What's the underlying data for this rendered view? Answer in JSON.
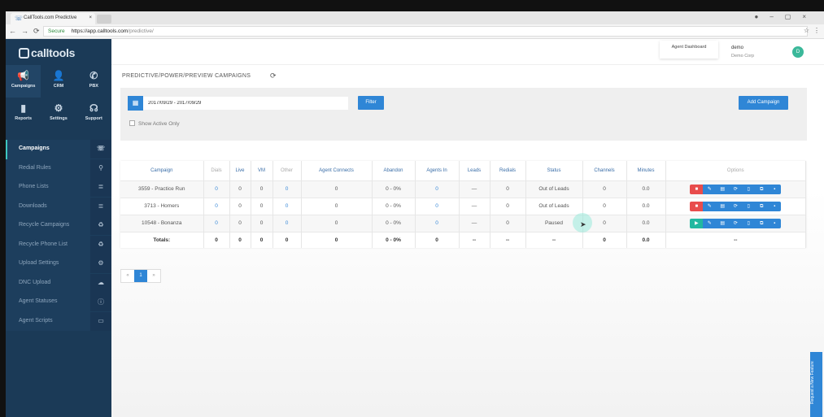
{
  "browser": {
    "tab_title": "CallTools.com Predictive",
    "url_secure": "Secure",
    "url_host": "https://app.calltools.com",
    "url_path": "/predictive/"
  },
  "sidebar": {
    "logo": "calltools",
    "grid": [
      {
        "label": "Campaigns",
        "icon": "megaphone-icon",
        "glyph": "📢"
      },
      {
        "label": "CRM",
        "icon": "user-icon",
        "glyph": "👤"
      },
      {
        "label": "PBX",
        "icon": "phone-icon",
        "glyph": "✆"
      },
      {
        "label": "Reports",
        "icon": "bar-chart-icon",
        "glyph": "▮"
      },
      {
        "label": "Settings",
        "icon": "gear-icon",
        "glyph": "⚙"
      },
      {
        "label": "Support",
        "icon": "headset-icon",
        "glyph": "☊"
      }
    ],
    "items": [
      {
        "label": "Campaigns",
        "icon": "phone-transfer-icon",
        "glyph": "☏"
      },
      {
        "label": "Redial Rules",
        "icon": "map-pin-icon",
        "glyph": "⚲"
      },
      {
        "label": "Phone Lists",
        "icon": "list-icon",
        "glyph": "≣"
      },
      {
        "label": "Downloads",
        "icon": "list-icon",
        "glyph": "≣"
      },
      {
        "label": "Recycle Campaigns",
        "icon": "recycle-icon",
        "glyph": "♻"
      },
      {
        "label": "Recycle Phone List",
        "icon": "recycle-icon",
        "glyph": "♻"
      },
      {
        "label": "Upload Settings",
        "icon": "gear-icon",
        "glyph": "⚙"
      },
      {
        "label": "DNC Upload",
        "icon": "cloud-upload-icon",
        "glyph": "☁"
      },
      {
        "label": "Agent Statuses",
        "icon": "info-icon",
        "glyph": "ⓘ"
      },
      {
        "label": "Agent Scripts",
        "icon": "chat-icon",
        "glyph": "▭"
      }
    ]
  },
  "header": {
    "agent_dashboard": "Agent Dashboard",
    "user": "demo",
    "org": "Demo Corp",
    "avatar": "D"
  },
  "page": {
    "title": "PREDICTIVE/POWER/PREVIEW CAMPAIGNS",
    "date_range": "2017/09/29 - 2017/09/29",
    "filter": "Filter",
    "add_campaign": "Add Campaign",
    "show_active_only": "Show Active Only"
  },
  "table": {
    "columns": [
      "Campaign",
      "Dials",
      "Live",
      "VM",
      "Other",
      "Agent Connects",
      "Abandon",
      "Agents In",
      "Leads",
      "Redials",
      "Status",
      "Channels",
      "Minutes",
      "Options"
    ],
    "rows": [
      {
        "campaign": "3559 - Practice Run",
        "dials": "0",
        "live": "0",
        "vm": "0",
        "other": "0",
        "agent_connects": "0",
        "abandon": "0 - 0%",
        "agents_in": "0",
        "leads": "—",
        "redials": "0",
        "status": "Out of Leads",
        "channels": "0",
        "minutes": "0.0",
        "state": "running"
      },
      {
        "campaign": "3713 - Homers",
        "dials": "0",
        "live": "0",
        "vm": "0",
        "other": "0",
        "agent_connects": "0",
        "abandon": "0 - 0%",
        "agents_in": "0",
        "leads": "—",
        "redials": "0",
        "status": "Out of Leads",
        "channels": "0",
        "minutes": "0.0",
        "state": "running"
      },
      {
        "campaign": "10548 - Bonanza",
        "dials": "0",
        "live": "0",
        "vm": "0",
        "other": "0",
        "agent_connects": "0",
        "abandon": "0 - 0%",
        "agents_in": "0",
        "leads": "—",
        "redials": "0",
        "status": "Paused",
        "channels": "0",
        "minutes": "0.0",
        "state": "paused"
      }
    ],
    "totals": {
      "campaign": "Totals:",
      "dials": "0",
      "live": "0",
      "vm": "0",
      "other": "0",
      "agent_connects": "0",
      "abandon": "0 - 0%",
      "agents_in": "0",
      "leads": "--",
      "redials": "--",
      "status": "--",
      "channels": "0",
      "minutes": "0.0",
      "options": "--"
    }
  },
  "pagination": {
    "prev": "«",
    "current": "1",
    "next": "»"
  },
  "feature_request": "Request a New Feature",
  "colors": {
    "sidebar": "#1b3a57",
    "primary": "#2f86d6",
    "stop": "#e84c4c",
    "play": "#22b8a0"
  }
}
